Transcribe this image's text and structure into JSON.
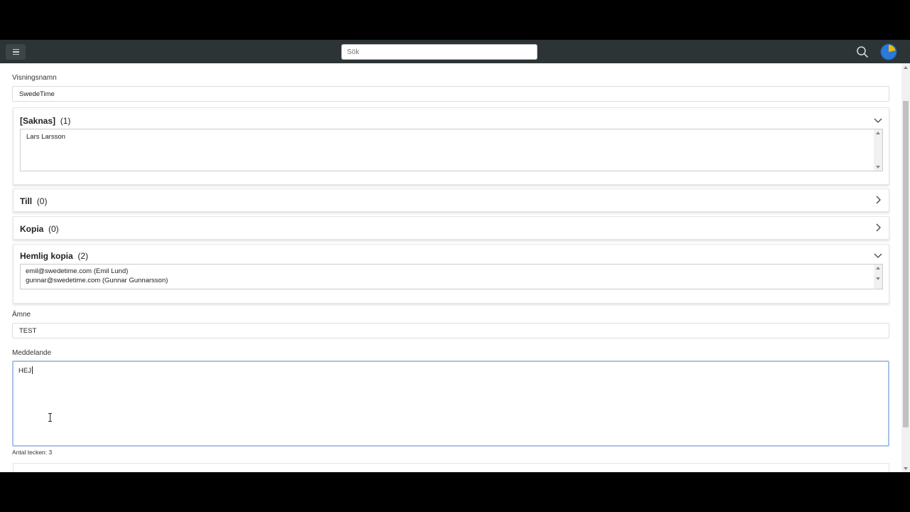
{
  "header": {
    "search_placeholder": "Sök",
    "icons": {
      "menu": "hamburger-menu-icon",
      "search": "search-icon",
      "avatar": "user-avatar"
    }
  },
  "form": {
    "display_name_label": "Visningsnamn",
    "display_name_value": "SwedeTime",
    "missing": {
      "title": "[Saknas]",
      "count": "(1)",
      "items": [
        "Lars Larsson"
      ]
    },
    "to": {
      "title": "Till",
      "count": "(0)"
    },
    "cc": {
      "title": "Kopia",
      "count": "(0)"
    },
    "bcc": {
      "title": "Hemlig kopia",
      "count": "(2)",
      "items": [
        "emil@swedetime.com (Emil Lund)",
        "gunnar@swedetime.com (Gunnar Gunnarsson)"
      ]
    },
    "subject_label": "Ämne",
    "subject_value": "TEST",
    "message_label": "Meddelande",
    "message_value": "HEJ",
    "char_count": "Antal tecken: 3"
  },
  "colors": {
    "topbar": "#2d3436",
    "focus_border": "#a8c2e8",
    "avatar_blue": "#2b7bd6",
    "avatar_yellow": "#f2b705"
  }
}
